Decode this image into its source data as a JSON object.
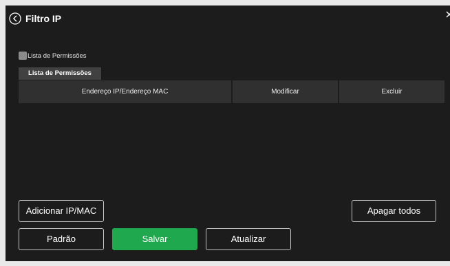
{
  "header": {
    "title": "Filtro IP",
    "back_icon": "chevron-left-circle-icon",
    "close_icon": "close-icon"
  },
  "allowlist": {
    "label": "Lista de Permissões",
    "checked": false
  },
  "tabs": [
    {
      "label": "Lista de Permissões",
      "active": true
    }
  ],
  "table": {
    "columns": [
      "Endereço IP/Endereço MAC",
      "Modificar",
      "Excluir"
    ],
    "rows": []
  },
  "buttons": {
    "add": "Adicionar IP/MAC",
    "clear_all": "Apagar todos",
    "default": "Padrão",
    "save": "Salvar",
    "refresh": "Atualizar"
  },
  "colors": {
    "panel": "#1c1c1c",
    "primary": "#1fa84d",
    "checkbox": "#8a8a8a"
  }
}
